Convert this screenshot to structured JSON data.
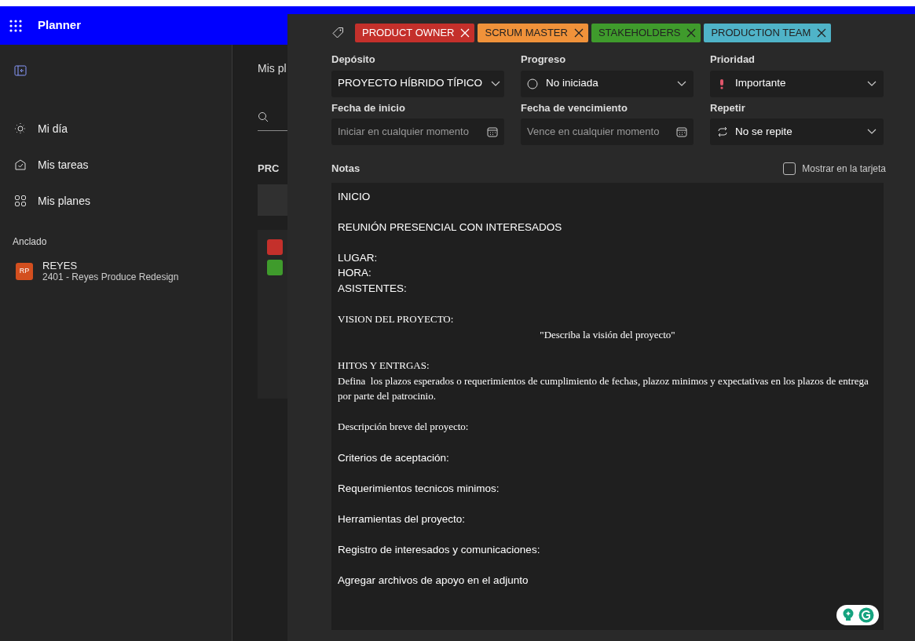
{
  "app": {
    "title": "Planner"
  },
  "sidebar": {
    "items": [
      {
        "label": "Mi día",
        "selected": false
      },
      {
        "label": "Mis tareas",
        "selected": false
      },
      {
        "label": "Mis planes",
        "selected": false
      }
    ],
    "pinned_heading": "Anclado",
    "pinned": [
      {
        "initials": "RP",
        "title": "REYES",
        "subtitle": "2401 - Reyes Produce Redesign",
        "color": "#d34f1f"
      }
    ]
  },
  "main": {
    "heading": "Mis pl",
    "column_title": "PRC",
    "card_tags": [
      {
        "color": "#c4302b"
      },
      {
        "color": "#3f9b2c"
      }
    ]
  },
  "task": {
    "labels": [
      {
        "text": "PRODUCT OWNER",
        "color": "#c4302b"
      },
      {
        "text": "SCRUM MASTER",
        "color": "#f0923a"
      },
      {
        "text": "STAKEHOLDERS",
        "color": "#3f9b2c"
      },
      {
        "text": "PRODUCTION TEAM",
        "color": "#4fb3c8"
      }
    ],
    "fields": [
      {
        "label": "Depósito",
        "kind": "select",
        "value": "PROYECTO HÍBRIDO TÍPICO"
      },
      {
        "label": "Progreso",
        "kind": "select",
        "value": "No iniciada"
      },
      {
        "label": "Prioridad",
        "kind": "select",
        "value": "Importante"
      },
      {
        "label": "Fecha de inicio",
        "kind": "date",
        "placeholder": "Iniciar en cualquier momento"
      },
      {
        "label": "Fecha de vencimiento",
        "kind": "date",
        "placeholder": "Vence en cualquier momento"
      },
      {
        "label": "Repetir",
        "kind": "select",
        "value": "No se repite"
      }
    ],
    "notes_label": "Notas",
    "show_on_card": {
      "label": "Mostrar en la tarjeta",
      "checked": false
    },
    "notes": [
      {
        "lines": [
          {
            "text": "INICIO",
            "kind": "sans"
          }
        ]
      },
      {
        "lines": [
          {
            "text": "REUNIÓN PRESENCIAL CON INTERESADOS",
            "kind": "sans"
          }
        ]
      },
      {
        "lines": [
          {
            "text": "LUGAR:",
            "kind": "sans"
          },
          {
            "text": "HORA:",
            "kind": "sans"
          },
          {
            "text": "ASISTENTES:",
            "kind": "sans"
          }
        ]
      },
      {
        "lines": [
          {
            "text": "VISION DEL PROYECTO:",
            "kind": "serif"
          },
          {
            "text": "\"Describa la visión del proyecto\"",
            "kind": "serif-center"
          }
        ]
      },
      {
        "lines": [
          {
            "text": "HITOS Y ENTRGAS:",
            "kind": "serif"
          },
          {
            "text": "Defina  los plazos esperados o requerimientos de cumplimiento de fechas, plazoz minimos y expectativas en los plazos de entrega por parte del patrocinio.",
            "kind": "serif"
          }
        ]
      },
      {
        "lines": [
          {
            "text": "Descripción breve del proyecto:",
            "kind": "serif"
          }
        ]
      },
      {
        "lines": [
          {
            "text": "Criterios de aceptación:",
            "kind": "sans"
          }
        ]
      },
      {
        "lines": [
          {
            "text": "Requerimientos tecnicos minimos:",
            "kind": "sans"
          }
        ]
      },
      {
        "lines": [
          {
            "text": "Herramientas del proyecto:",
            "kind": "sans"
          }
        ]
      },
      {
        "lines": [
          {
            "text": "Registro de interesados y comunicaciones:",
            "kind": "sans"
          }
        ]
      },
      {
        "lines": [
          {
            "text": "Agregar archivos de apoyo en el adjunto",
            "kind": "sans"
          }
        ]
      }
    ]
  }
}
